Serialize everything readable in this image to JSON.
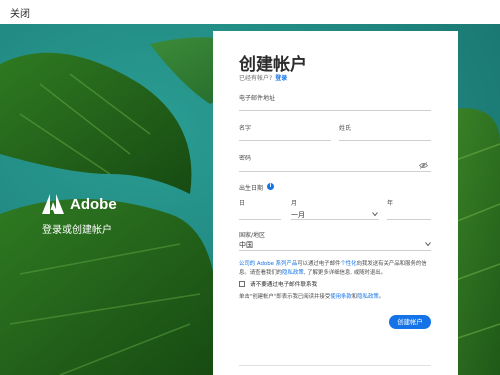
{
  "topbar": {
    "close_label": "关闭"
  },
  "brand": {
    "name": "Adobe",
    "tagline": "登录或创建帐户"
  },
  "form": {
    "title": "创建帐户",
    "have_account_text": "已经有帐户?",
    "sign_in_link": "登录",
    "email_label": "电子邮件地址",
    "first_name_label": "名字",
    "last_name_label": "姓氏",
    "password_label": "密码",
    "birthdate_label": "出生日期",
    "day_label": "日",
    "month_label": "月",
    "month_value": "一月",
    "year_label": "年",
    "country_label": "国家/地区",
    "country_value": "中国",
    "notice": {
      "part1": "公司的 Adobe 系列产品",
      "part2": "可以通过电子邮件",
      "part3": "个性化",
      "part4": "向我发送有关产品和服务的信息。请查看我们的",
      "part5": "隐私政策",
      "part6": ", 了解更多详细信息, 或随时退出。"
    },
    "opt_out_label": "请不要通过电子邮件联系我",
    "terms": {
      "prefix": "单击\"创建帐户\"即表示我已阅读并接受",
      "terms_link": "使用条款",
      "and": "和",
      "privacy_link": "隐私政策",
      "suffix": "。"
    },
    "submit_label": "创建帐户"
  },
  "colors": {
    "accent": "#1473e6",
    "background": "#1f7f7a"
  }
}
